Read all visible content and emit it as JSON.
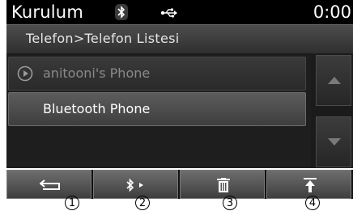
{
  "status": {
    "title": "Kurulum",
    "clock": "0:00",
    "icons": [
      "bluetooth-icon",
      "usb-icon"
    ]
  },
  "breadcrumb": "Telefon>Telefon Listesi",
  "phone_list": {
    "items": [
      {
        "label": "anitooni's Phone",
        "state": "disabled",
        "icon": "play-icon"
      },
      {
        "label": "Bluetooth Phone",
        "state": "selected"
      }
    ]
  },
  "scroll": {
    "up_icon": "chevron-up-icon",
    "down_icon": "chevron-down-icon"
  },
  "toolbar": {
    "buttons": [
      {
        "icon": "back-arrow-icon"
      },
      {
        "icon": "bluetooth-connect-icon"
      },
      {
        "icon": "trash-icon"
      },
      {
        "icon": "move-to-top-icon"
      }
    ]
  },
  "callouts": [
    "1",
    "2",
    "3",
    "4"
  ],
  "colors": {
    "background": "#1b1b1b",
    "button": "#5a5a5a",
    "disabled_text": "#8a8a8a",
    "text": "#ffffff"
  }
}
